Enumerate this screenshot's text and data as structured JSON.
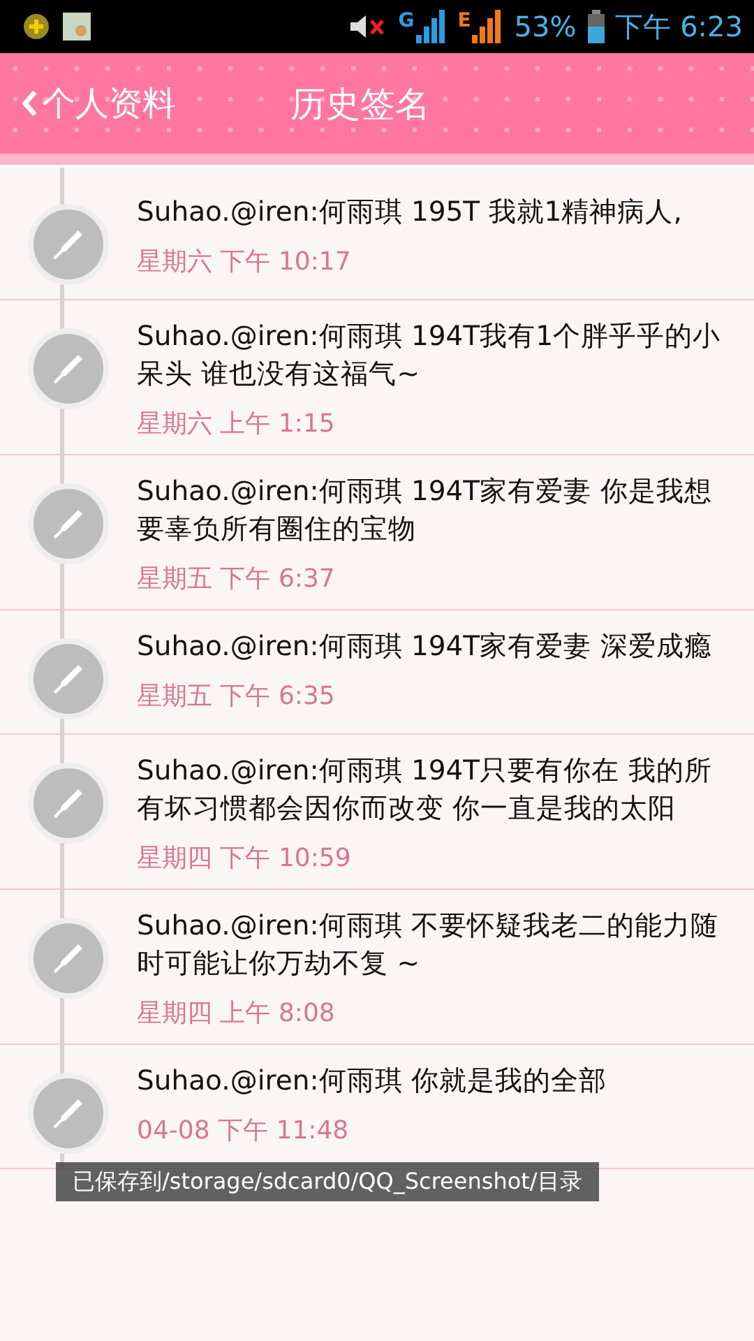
{
  "status_bar": {
    "battery_text": "53%",
    "time": "下午 6:23",
    "signal_labels": [
      "G",
      "E"
    ]
  },
  "header": {
    "back_label": "个人资料",
    "title": "历史签名"
  },
  "entries": [
    {
      "text": "Suhao.@iren:何雨琪  195T 我就1精神病人,",
      "time": "星期六 下午 10:17"
    },
    {
      "text": "Suhao.@iren:何雨琪  194T我有1个胖乎乎的小呆头 谁也没有这福气~",
      "time": "星期六 上午 1:15"
    },
    {
      "text": "Suhao.@iren:何雨琪  194T家有爱妻  你是我想要辜负所有圈住的宝物",
      "time": "星期五 下午 6:37"
    },
    {
      "text": "Suhao.@iren:何雨琪  194T家有爱妻  深爱成瘾",
      "time": "星期五 下午 6:35"
    },
    {
      "text": "Suhao.@iren:何雨琪  194T只要有你在  我的所有坏习惯都会因你而改变 你一直是我的太阳",
      "time": "星期四 下午 10:59"
    },
    {
      "text": "Suhao.@iren:何雨琪   不要怀疑我老二的能力随时可能让你万劫不复 ~",
      "time": "星期四 上午 8:08"
    },
    {
      "text": "Suhao.@iren:何雨琪   你就是我的全部",
      "time": "04-08 下午 11:48"
    }
  ],
  "toast": {
    "text": "已保存到/storage/sdcard0/QQ_Screenshot/目录"
  }
}
